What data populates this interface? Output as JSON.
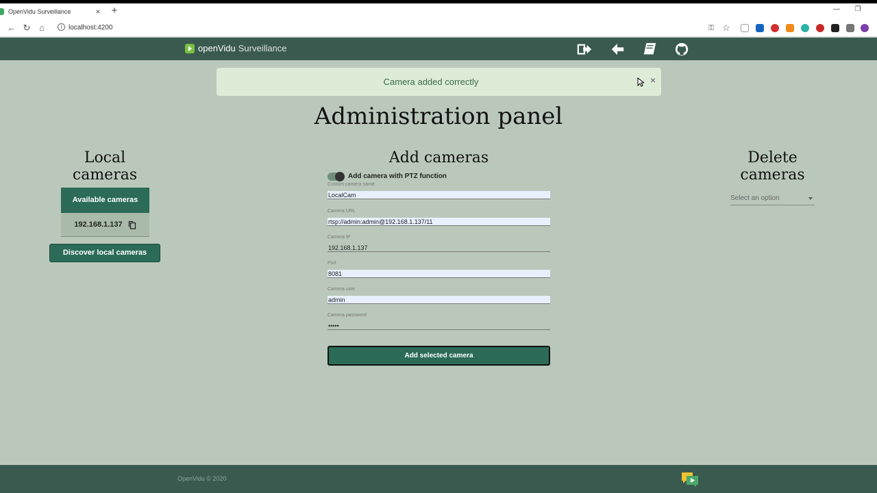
{
  "browser": {
    "tab_title": "OpenVidu Surveillance",
    "url": "localhost:4200"
  },
  "header": {
    "brand_name": "openVidu",
    "brand_sub": "Surveillance",
    "icons": [
      "logout-icon",
      "back-arrow-icon",
      "docs-book-icon",
      "github-icon"
    ]
  },
  "alert": {
    "message": "Camera added correctly",
    "close_symbol": "×"
  },
  "page_title": "Administration panel",
  "local_cameras": {
    "title_line1": "Local",
    "title_line2": "cameras",
    "table_header": "Available cameras",
    "cameras": [
      "192.168.1.137"
    ],
    "discover_button": "Discover local cameras"
  },
  "add_cameras": {
    "title": "Add cameras",
    "ptz_toggle_label": "Add camera with PTZ function",
    "ptz_enabled": true,
    "fields": [
      {
        "label": "Custom camera name",
        "value": "LocalCam"
      },
      {
        "label": "Camera URL",
        "value": "rtsp://admin:admin@192.168.1.137/11"
      },
      {
        "label": "Camera IP",
        "value": "192.168.1.137"
      },
      {
        "label": "Port",
        "value": "8081"
      },
      {
        "label": "Camera user",
        "value": "admin"
      },
      {
        "label": "Camera password",
        "value": "•••••"
      }
    ],
    "submit_button": "Add selected camera"
  },
  "delete_cameras": {
    "title_line1": "Delete",
    "title_line2": "cameras",
    "select_placeholder": "Select an option"
  },
  "footer": {
    "copyright": "OpenVidu © 2020"
  },
  "colors": {
    "primary": "#2b6b57",
    "header_bg": "#3a5a50",
    "page_bg": "#bac8bb",
    "alert_bg": "#dcecd7"
  }
}
